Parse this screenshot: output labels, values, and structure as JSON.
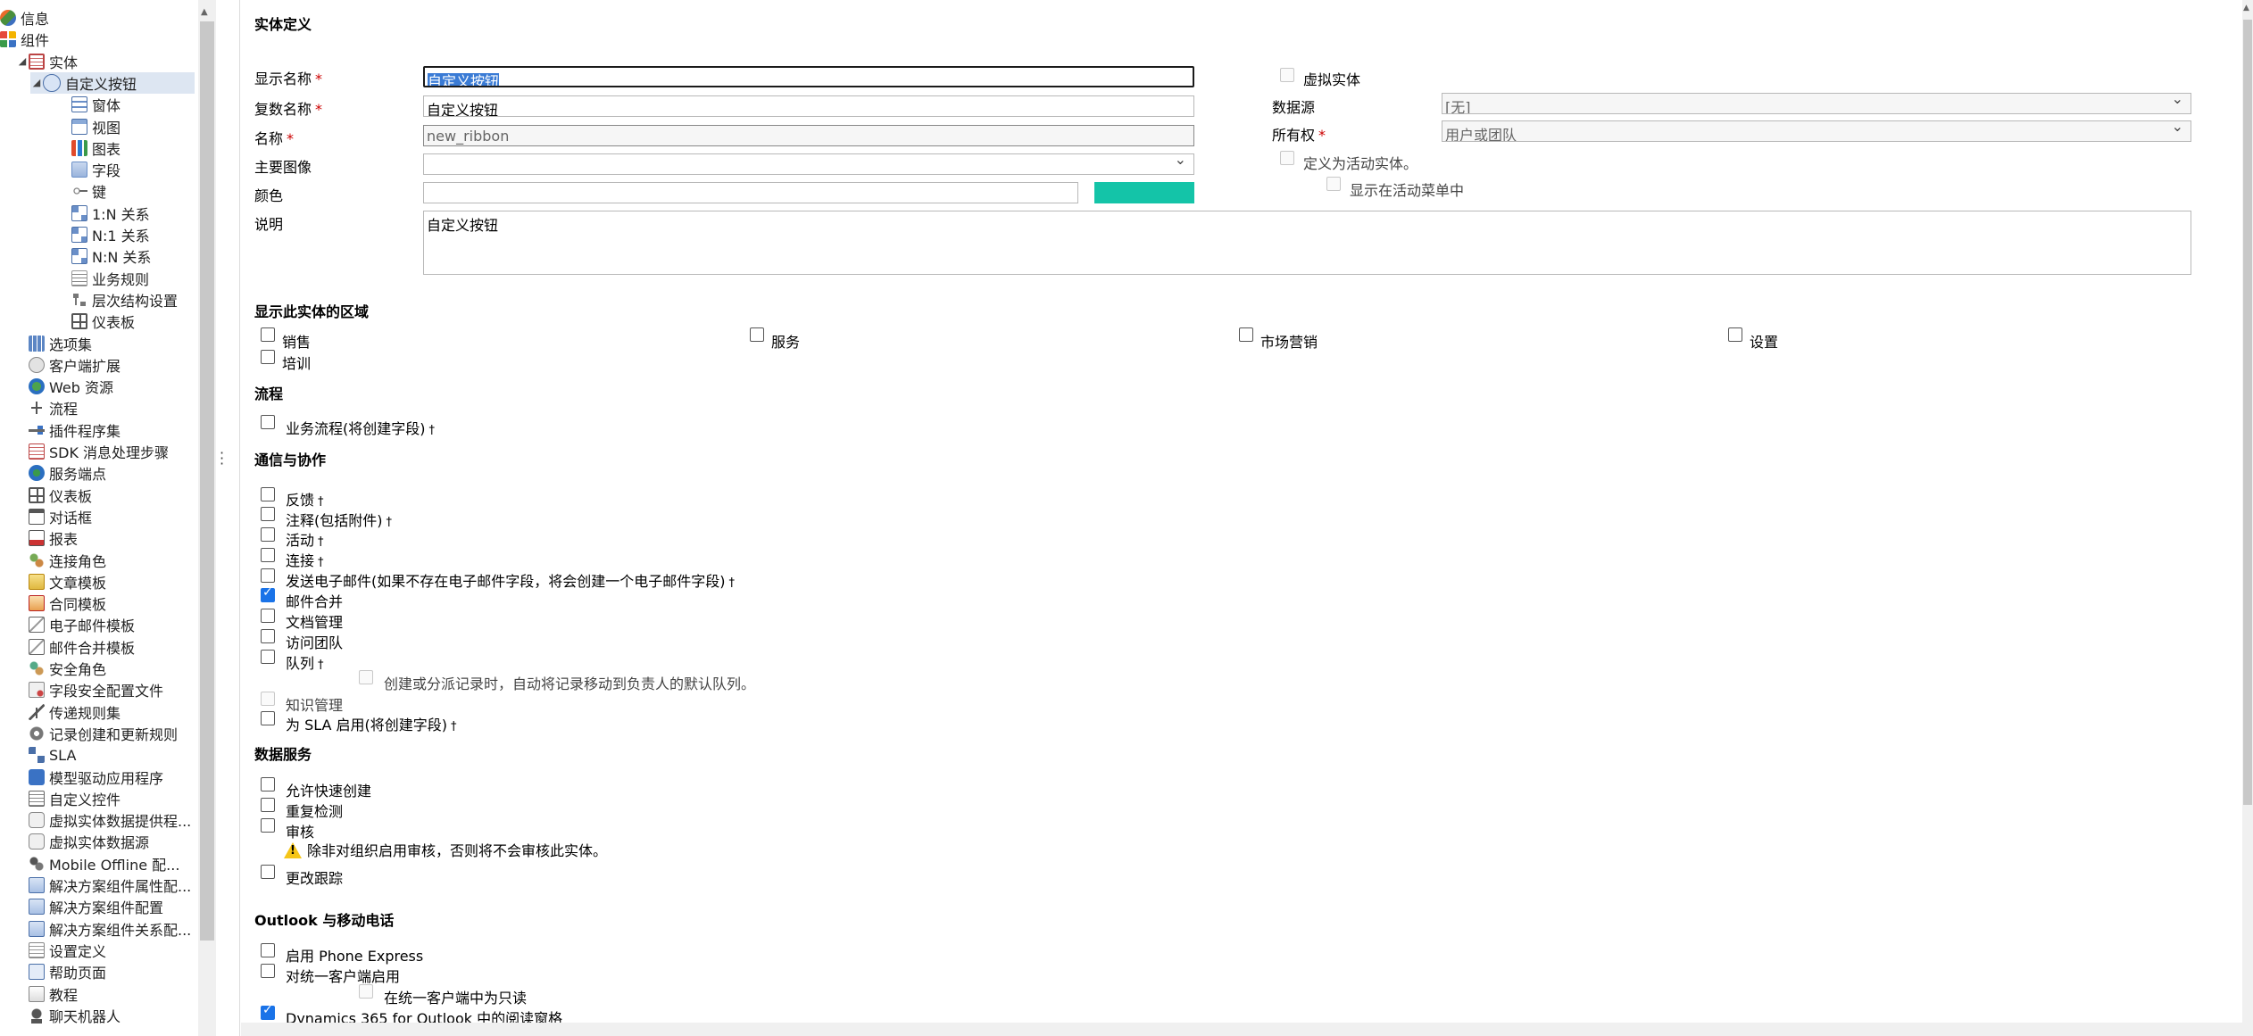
{
  "tree": {
    "items": [
      {
        "label": "信息",
        "icon": "info-icon",
        "level": 0,
        "exp": ""
      },
      {
        "label": "组件",
        "icon": "components-icon",
        "level": 0,
        "exp": ""
      },
      {
        "label": "实体",
        "icon": "entity-icon",
        "level": 1,
        "exp": "◢"
      },
      {
        "label": "自定义按钮",
        "icon": "custom-entity-icon",
        "level": 2,
        "exp": "◢",
        "selected": true
      },
      {
        "label": "窗体",
        "icon": "form-icon",
        "level": 3,
        "exp": ""
      },
      {
        "label": "视图",
        "icon": "view-icon",
        "level": 3,
        "exp": ""
      },
      {
        "label": "图表",
        "icon": "chart-icon",
        "level": 3,
        "exp": ""
      },
      {
        "label": "字段",
        "icon": "field-icon",
        "level": 3,
        "exp": ""
      },
      {
        "label": "键",
        "icon": "key-icon",
        "level": 3,
        "exp": ""
      },
      {
        "label": "1:N 关系",
        "icon": "relationship-icon",
        "level": 3,
        "exp": ""
      },
      {
        "label": "N:1 关系",
        "icon": "relationship-icon",
        "level": 3,
        "exp": ""
      },
      {
        "label": "N:N 关系",
        "icon": "relationship-icon",
        "level": 3,
        "exp": ""
      },
      {
        "label": "业务规则",
        "icon": "business-rule-icon",
        "level": 3,
        "exp": ""
      },
      {
        "label": "层次结构设置",
        "icon": "hierarchy-icon",
        "level": 3,
        "exp": ""
      },
      {
        "label": "仪表板",
        "icon": "dashboard-icon",
        "level": 3,
        "exp": ""
      },
      {
        "label": "选项集",
        "icon": "option-set-icon",
        "level": 1,
        "exp": ""
      },
      {
        "label": "客户端扩展",
        "icon": "client-extension-icon",
        "level": 1,
        "exp": ""
      },
      {
        "label": "Web 资源",
        "icon": "web-resource-icon",
        "level": 1,
        "exp": ""
      },
      {
        "label": "流程",
        "icon": "process-icon",
        "level": 1,
        "exp": ""
      },
      {
        "label": "插件程序集",
        "icon": "plugin-assembly-icon",
        "level": 1,
        "exp": ""
      },
      {
        "label": "SDK 消息处理步骤",
        "icon": "sdk-step-icon",
        "level": 1,
        "exp": ""
      },
      {
        "label": "服务端点",
        "icon": "service-endpoint-icon",
        "level": 1,
        "exp": ""
      },
      {
        "label": "仪表板",
        "icon": "dashboard-icon",
        "level": 1,
        "exp": ""
      },
      {
        "label": "对话框",
        "icon": "dialog-icon",
        "level": 1,
        "exp": ""
      },
      {
        "label": "报表",
        "icon": "report-icon",
        "level": 1,
        "exp": ""
      },
      {
        "label": "连接角色",
        "icon": "connection-role-icon",
        "level": 1,
        "exp": ""
      },
      {
        "label": "文章模板",
        "icon": "article-template-icon",
        "level": 1,
        "exp": ""
      },
      {
        "label": "合同模板",
        "icon": "contract-template-icon",
        "level": 1,
        "exp": ""
      },
      {
        "label": "电子邮件模板",
        "icon": "email-template-icon",
        "level": 1,
        "exp": ""
      },
      {
        "label": "邮件合并模板",
        "icon": "mail-merge-template-icon",
        "level": 1,
        "exp": ""
      },
      {
        "label": "安全角色",
        "icon": "security-role-icon",
        "level": 1,
        "exp": ""
      },
      {
        "label": "字段安全配置文件",
        "icon": "field-security-icon",
        "level": 1,
        "exp": ""
      },
      {
        "label": "传递规则集",
        "icon": "routing-rule-icon",
        "level": 1,
        "exp": ""
      },
      {
        "label": "记录创建和更新规则",
        "icon": "record-rule-gear-icon",
        "level": 1,
        "exp": ""
      },
      {
        "label": "SLA",
        "icon": "sla-icon",
        "level": 1,
        "exp": ""
      },
      {
        "label": "模型驱动应用程序",
        "icon": "app-icon",
        "level": 1,
        "exp": ""
      },
      {
        "label": "自定义控件",
        "icon": "custom-control-icon",
        "level": 1,
        "exp": ""
      },
      {
        "label": "虚拟实体数据提供程...",
        "icon": "virtual-provider-icon",
        "level": 1,
        "exp": ""
      },
      {
        "label": "虚拟实体数据源",
        "icon": "virtual-source-icon",
        "level": 1,
        "exp": ""
      },
      {
        "label": "Mobile Offline 配...",
        "icon": "mobile-offline-icon",
        "level": 1,
        "exp": ""
      },
      {
        "label": "解决方案组件属性配...",
        "icon": "solution-attr-icon",
        "level": 1,
        "exp": ""
      },
      {
        "label": "解决方案组件配置",
        "icon": "solution-config-icon",
        "level": 1,
        "exp": ""
      },
      {
        "label": "解决方案组件关系配...",
        "icon": "solution-rel-icon",
        "level": 1,
        "exp": ""
      },
      {
        "label": "设置定义",
        "icon": "setting-definition-icon",
        "level": 1,
        "exp": ""
      },
      {
        "label": "帮助页面",
        "icon": "help-page-icon",
        "level": 1,
        "exp": ""
      },
      {
        "label": "教程",
        "icon": "tutorial-icon",
        "level": 1,
        "exp": ""
      },
      {
        "label": "聊天机器人",
        "icon": "chatbot-icon",
        "level": 1,
        "exp": ""
      }
    ]
  },
  "definition": {
    "title": "实体定义",
    "display_name_label": "显示名称",
    "display_name_value": "自定义按钮",
    "plural_name_label": "复数名称",
    "plural_name_value": "自定义按钮",
    "name_label": "名称",
    "name_value": "new_ribbon",
    "primary_image_label": "主要图像",
    "primary_image_value": "",
    "color_label": "颜色",
    "color_value": "",
    "color_swatch": "#14c4a8",
    "description_label": "说明",
    "description_value": "自定义按钮",
    "virtual_entity_label": "虚拟实体",
    "datasource_label": "数据源",
    "datasource_value": "[无]",
    "ownership_label": "所有权",
    "ownership_value": "用户或团队",
    "activity_entity_label": "定义为活动实体。",
    "activity_menu_label": "显示在活动菜单中",
    "required_mark": "*"
  },
  "areas": {
    "title": "显示此实体的区域",
    "items": [
      {
        "label": "销售",
        "checked": false
      },
      {
        "label": "服务",
        "checked": false
      },
      {
        "label": "市场营销",
        "checked": false
      },
      {
        "label": "设置",
        "checked": false
      },
      {
        "label": "培训",
        "checked": false
      }
    ]
  },
  "process": {
    "title": "流程",
    "business_process_label": "业务流程(将创建字段)",
    "dagger": "†"
  },
  "communication": {
    "title": "通信与协作",
    "feedback_label": "反馈",
    "notes_label": "注释(包括附件)",
    "activities_label": "活动",
    "connections_label": "连接",
    "send_email_label": "发送电子邮件(如果不存在电子邮件字段，将会创建一个电子邮件字段)",
    "mail_merge_label": "邮件合并",
    "document_mgmt_label": "文档管理",
    "access_teams_label": "访问团队",
    "queues_label": "队列",
    "queue_auto_move_label": "创建或分派记录时，自动将记录移动到负责人的默认队列。",
    "knowledge_label": "知识管理",
    "sla_label": "为 SLA 启用(将创建字段)"
  },
  "data_services": {
    "title": "数据服务",
    "quick_create_label": "允许快速创建",
    "duplicate_label": "重复检测",
    "auditing_label": "审核",
    "audit_warning": "除非对组织启用审核，否则将不会审核此实体。",
    "change_tracking_label": "更改跟踪"
  },
  "outlook": {
    "title": "Outlook 与移动电话",
    "phone_express_label": "启用 Phone Express",
    "unified_client_label": "对统一客户端启用",
    "unified_readonly_label": "在统一客户端中为只读",
    "reading_pane_label": "Dynamics 365 for Outlook 中的阅读窗格"
  }
}
